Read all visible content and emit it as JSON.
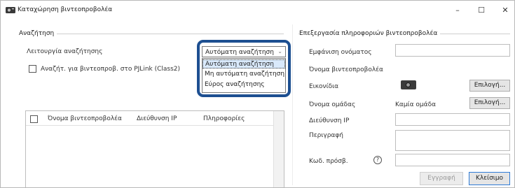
{
  "window": {
    "title": "Καταχώρηση βιντεοπροβολέα",
    "minimize": "–",
    "maximize": "☐",
    "close": "✕"
  },
  "search": {
    "group_title": "Αναζήτηση",
    "mode_label": "Λειτουργία αναζήτησης",
    "mode_selected": "Αυτόματη αναζήτηση",
    "mode_options": [
      "Αυτόματη αναζήτηση",
      "Μη αυτόματη αναζήτηση",
      "Εύρος αναζήτησης"
    ],
    "pjlink_checkbox_label": "Αναζήτ. για βιντεοπροβ. στο PJLink (Class2)",
    "pjlink_checked": false
  },
  "table": {
    "headers": [
      "Όνομα βιντεοπροβολέα",
      "Διεύθυνση IP",
      "Πληροφορίες"
    ],
    "rows": []
  },
  "edit": {
    "group_title": "Επεξεργασία πληροφοριών βιντεοπροβολέα",
    "display_name_label": "Εμφάνιση ονόματος",
    "display_name_value": "",
    "projector_name_label": "Όνομα βιντεοπροβολέα",
    "icon_label": "Εικονίδια",
    "icon_select_button": "Επιλογή...",
    "group_name_label": "Όνομα ομάδας",
    "group_name_value": "Καμία ομάδα",
    "group_select_button": "Επιλογή...",
    "ip_label": "Διεύθυνση IP",
    "ip_value": "",
    "description_label": "Περιγραφή",
    "description_value": "",
    "password_label": "Κωδ. πρόσβ.",
    "password_value": "",
    "help_icon": "?"
  },
  "footer": {
    "register_button": "Εγγραφή",
    "close_button": "Κλείσιμο"
  },
  "colors": {
    "highlight_border": "#1d4f91",
    "selected_item_bg": "#d9e9fb",
    "primary_button_border": "#2e7bd6"
  }
}
